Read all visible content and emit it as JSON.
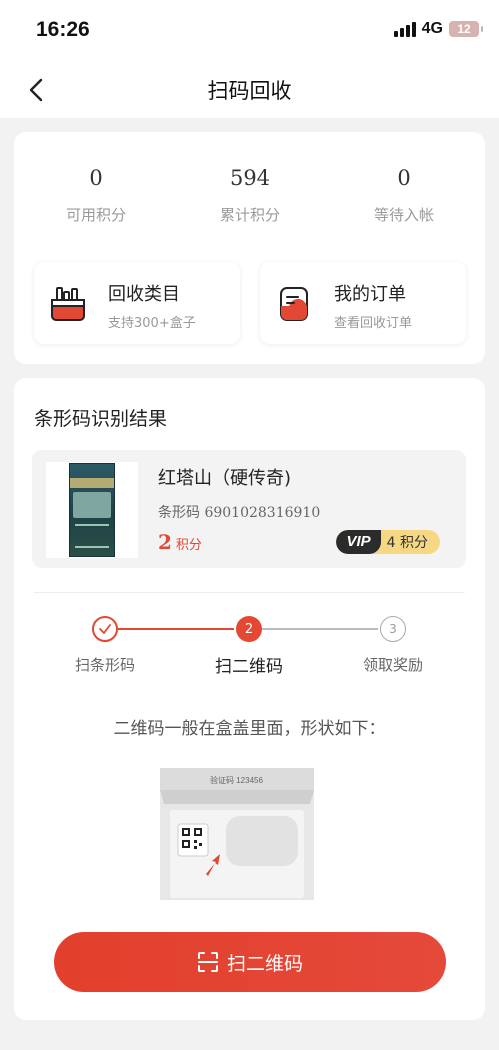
{
  "status": {
    "time": "16:26",
    "network": "4G",
    "battery": "12"
  },
  "header": {
    "title": "扫码回收"
  },
  "stats": [
    {
      "value": "0",
      "label": "可用积分"
    },
    {
      "value": "594",
      "label": "累计积分"
    },
    {
      "value": "0",
      "label": "等待入帐"
    }
  ],
  "quick_actions": [
    {
      "title": "回收类目",
      "subtitle": "支持300+盒子",
      "icon": "recycle-bag-icon"
    },
    {
      "title": "我的订单",
      "subtitle": "查看回收订单",
      "icon": "order-icon"
    }
  ],
  "result": {
    "section_title": "条形码识别结果",
    "product": {
      "name": "红塔山（硬传奇)",
      "barcode_label": "条形码",
      "barcode": "6901028316910",
      "points": "2",
      "points_unit": "积分",
      "vip_label": "VIP",
      "vip_points": "4 积分"
    },
    "steps": [
      {
        "label": "扫条形码",
        "state": "done"
      },
      {
        "label": "扫二维码",
        "number": "2",
        "state": "current"
      },
      {
        "label": "领取奖励",
        "number": "3",
        "state": "todo"
      }
    ],
    "hint": "二维码一般在盒盖里面，形状如下：",
    "illustration_code": "验证码 123456",
    "scan_button": "扫二维码"
  },
  "colors": {
    "accent": "#e24834",
    "vip_gold": "#f6d884"
  }
}
